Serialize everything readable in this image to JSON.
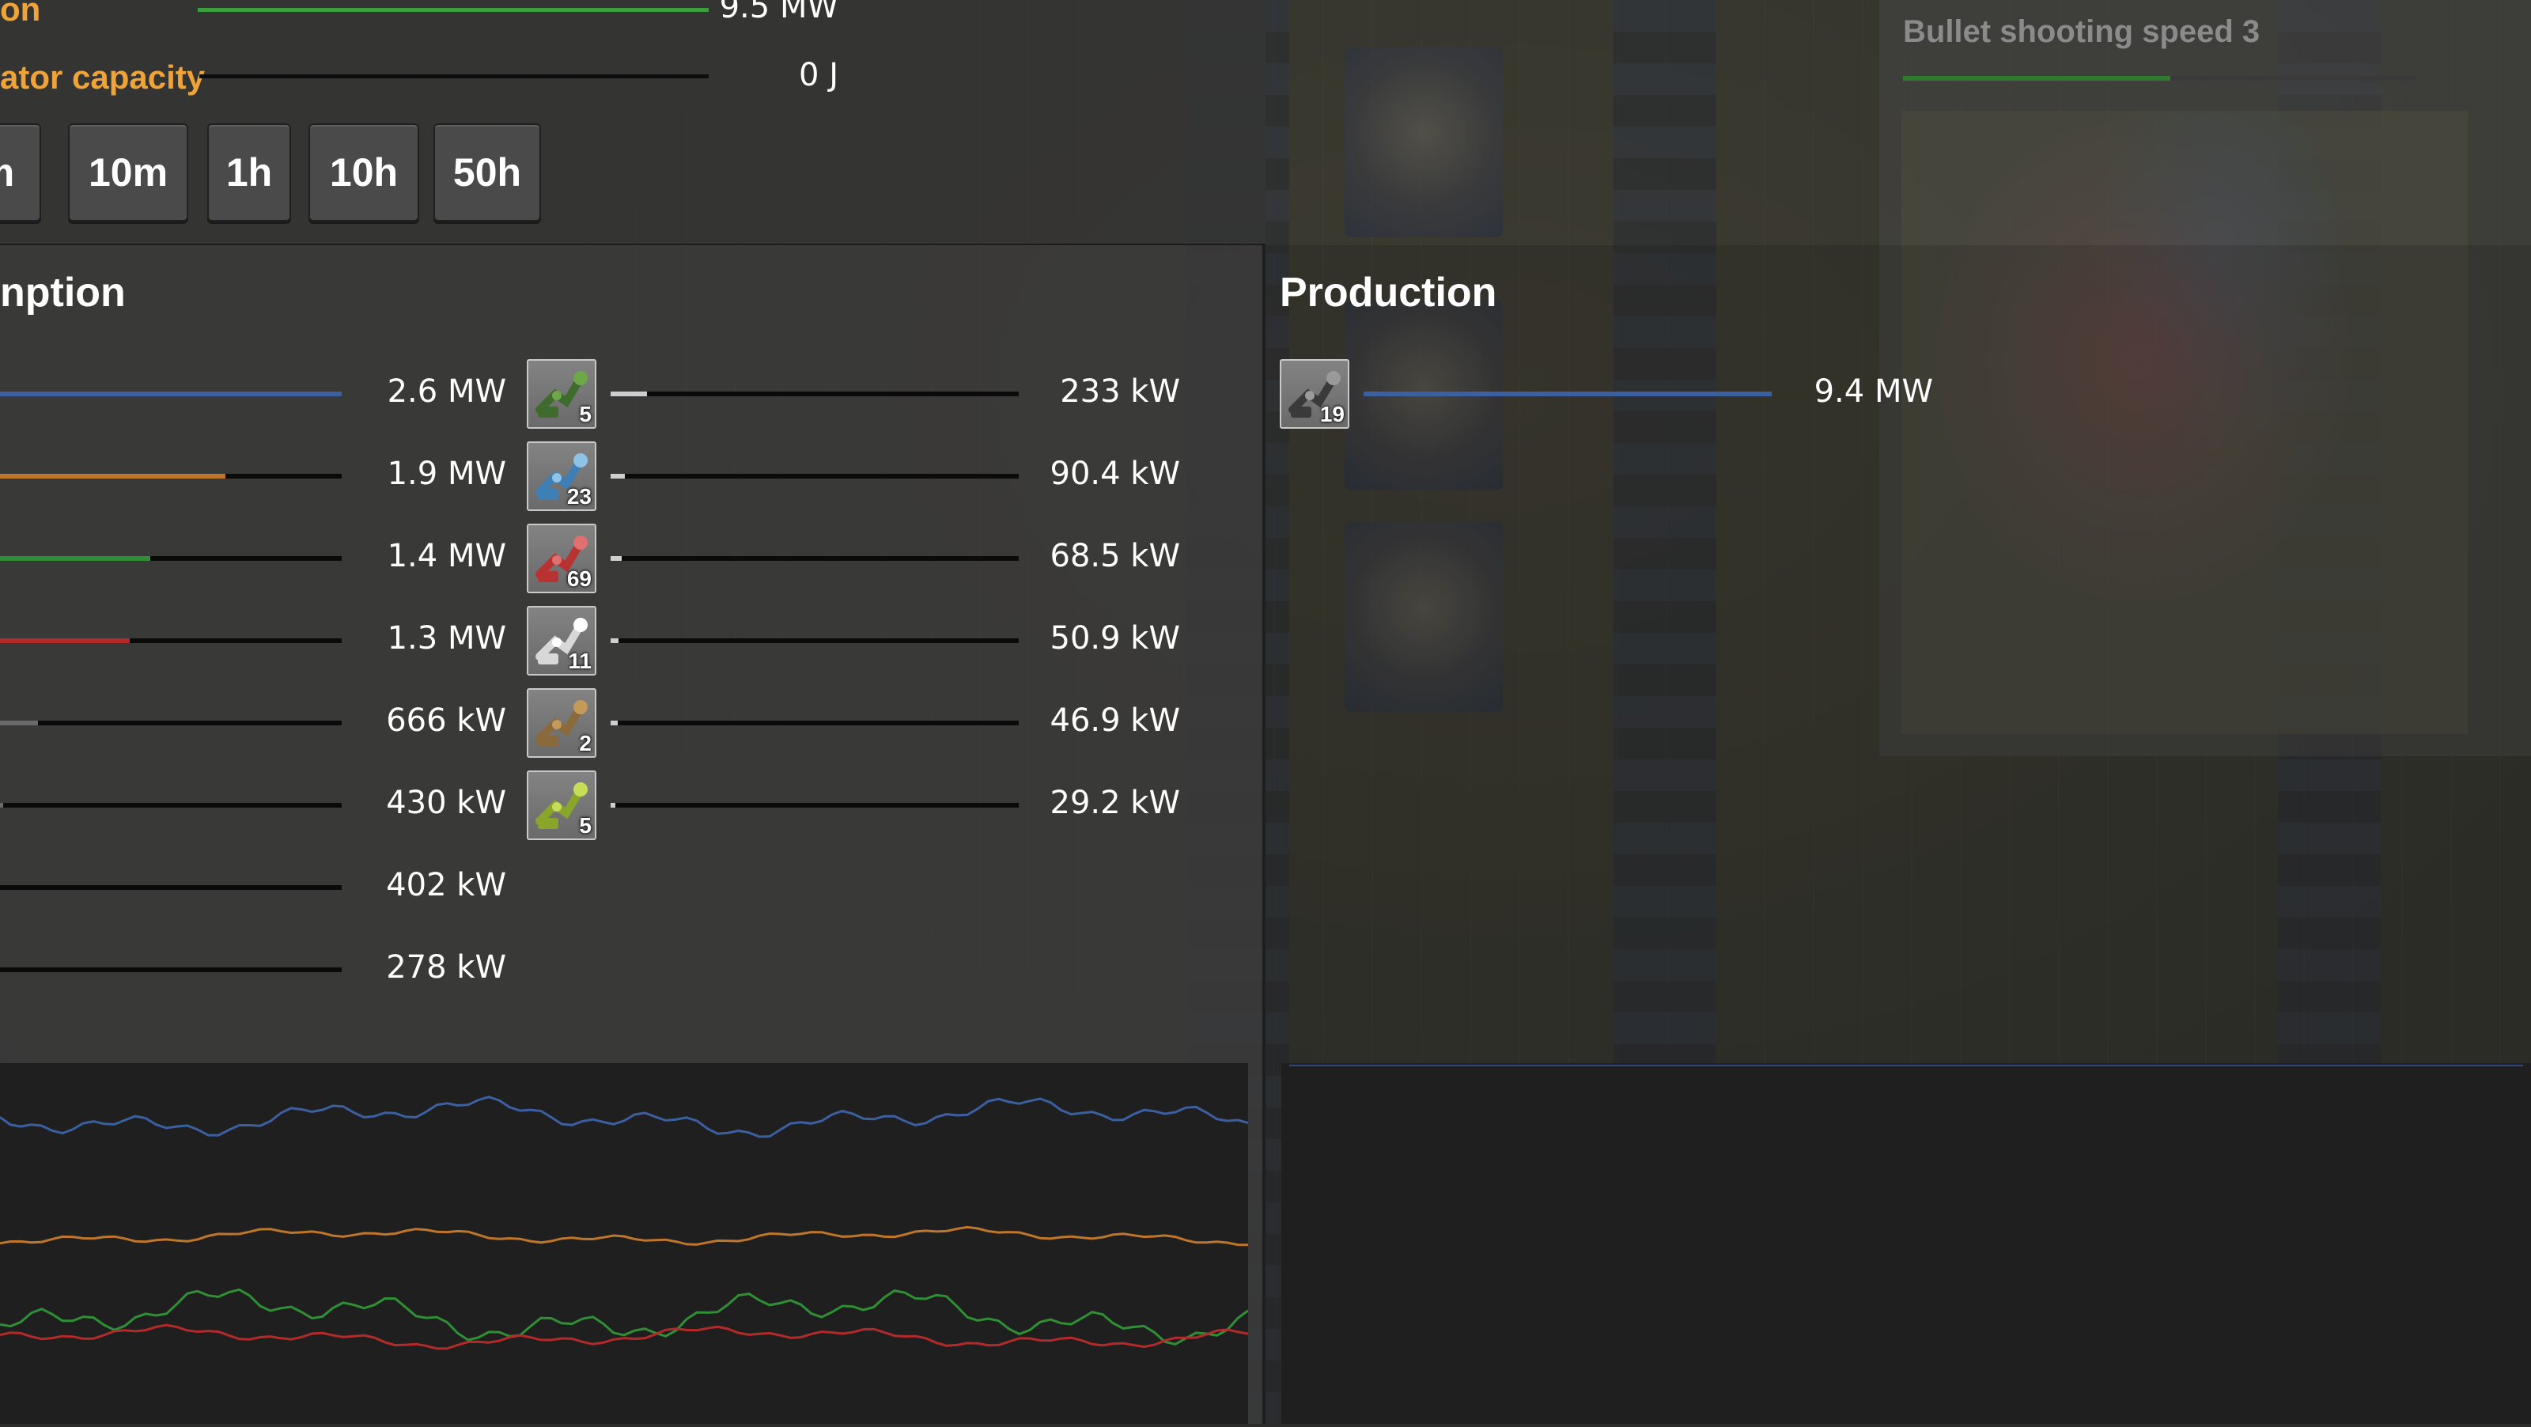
{
  "stats": [
    {
      "label": "on",
      "value": "9.5 MW",
      "fill": 1.0,
      "color": "#3aa13a"
    },
    {
      "label": "ator capacity",
      "value": "0 J",
      "fill": 0.0,
      "color": "#3aa13a"
    }
  ],
  "time_buttons": [
    "m",
    "10m",
    "1h",
    "10h",
    "50h"
  ],
  "consumption": {
    "title": "nption",
    "left_rows": [
      {
        "value": "2.6 MW",
        "fill": 1.0,
        "color": "#3b5fa0"
      },
      {
        "value": "1.9 MW",
        "fill": 0.66,
        "color": "#c0762a"
      },
      {
        "value": "1.4 MW",
        "fill": 0.44,
        "color": "#2f8f35"
      },
      {
        "value": "1.3 MW",
        "fill": 0.38,
        "color": "#b42a2a"
      },
      {
        "value": "666 kW",
        "fill": 0.11,
        "color": "#6a6a6a"
      },
      {
        "value": "430 kW",
        "fill": 0.01,
        "color": "#6a6a6a"
      },
      {
        "value": "402 kW",
        "fill": 0.0,
        "color": "#6a6a6a"
      },
      {
        "value": "278 kW",
        "fill": 0.0,
        "color": "#6a6a6a"
      }
    ],
    "right_rows": [
      {
        "icon": "pumpjack-icon",
        "count": "5",
        "value": "233 kW",
        "fill": 0.09
      },
      {
        "icon": "fast-inserter-icon",
        "count": "23",
        "value": "90.4 kW",
        "fill": 0.035
      },
      {
        "icon": "long-handed-inserter-icon",
        "count": "69",
        "value": "68.5 kW",
        "fill": 0.027
      },
      {
        "icon": "lamp-icon",
        "count": "11",
        "value": "50.9 kW",
        "fill": 0.02
      },
      {
        "icon": "radar-icon",
        "count": "2",
        "value": "46.9 kW",
        "fill": 0.018
      },
      {
        "icon": "inserter-icon",
        "count": "5",
        "value": "29.2 kW",
        "fill": 0.011
      }
    ]
  },
  "production": {
    "title": "Production",
    "rows": [
      {
        "icon": "steam-engine-icon",
        "count": "19",
        "value": "9.4 MW",
        "fill": 1.0,
        "color": "#3b5fa0"
      }
    ]
  },
  "research": {
    "title": "Bullet shooting speed 3",
    "progress": 0.52
  },
  "graph_series": [
    {
      "color": "#3b5fa0",
      "base": 0.15,
      "amp": 0.035
    },
    {
      "color": "#c0762a",
      "base": 0.48,
      "amp": 0.015
    },
    {
      "color": "#2f8f35",
      "base": 0.7,
      "amp": 0.05
    },
    {
      "color": "#b42a2a",
      "base": 0.76,
      "amp": 0.02
    }
  ]
}
